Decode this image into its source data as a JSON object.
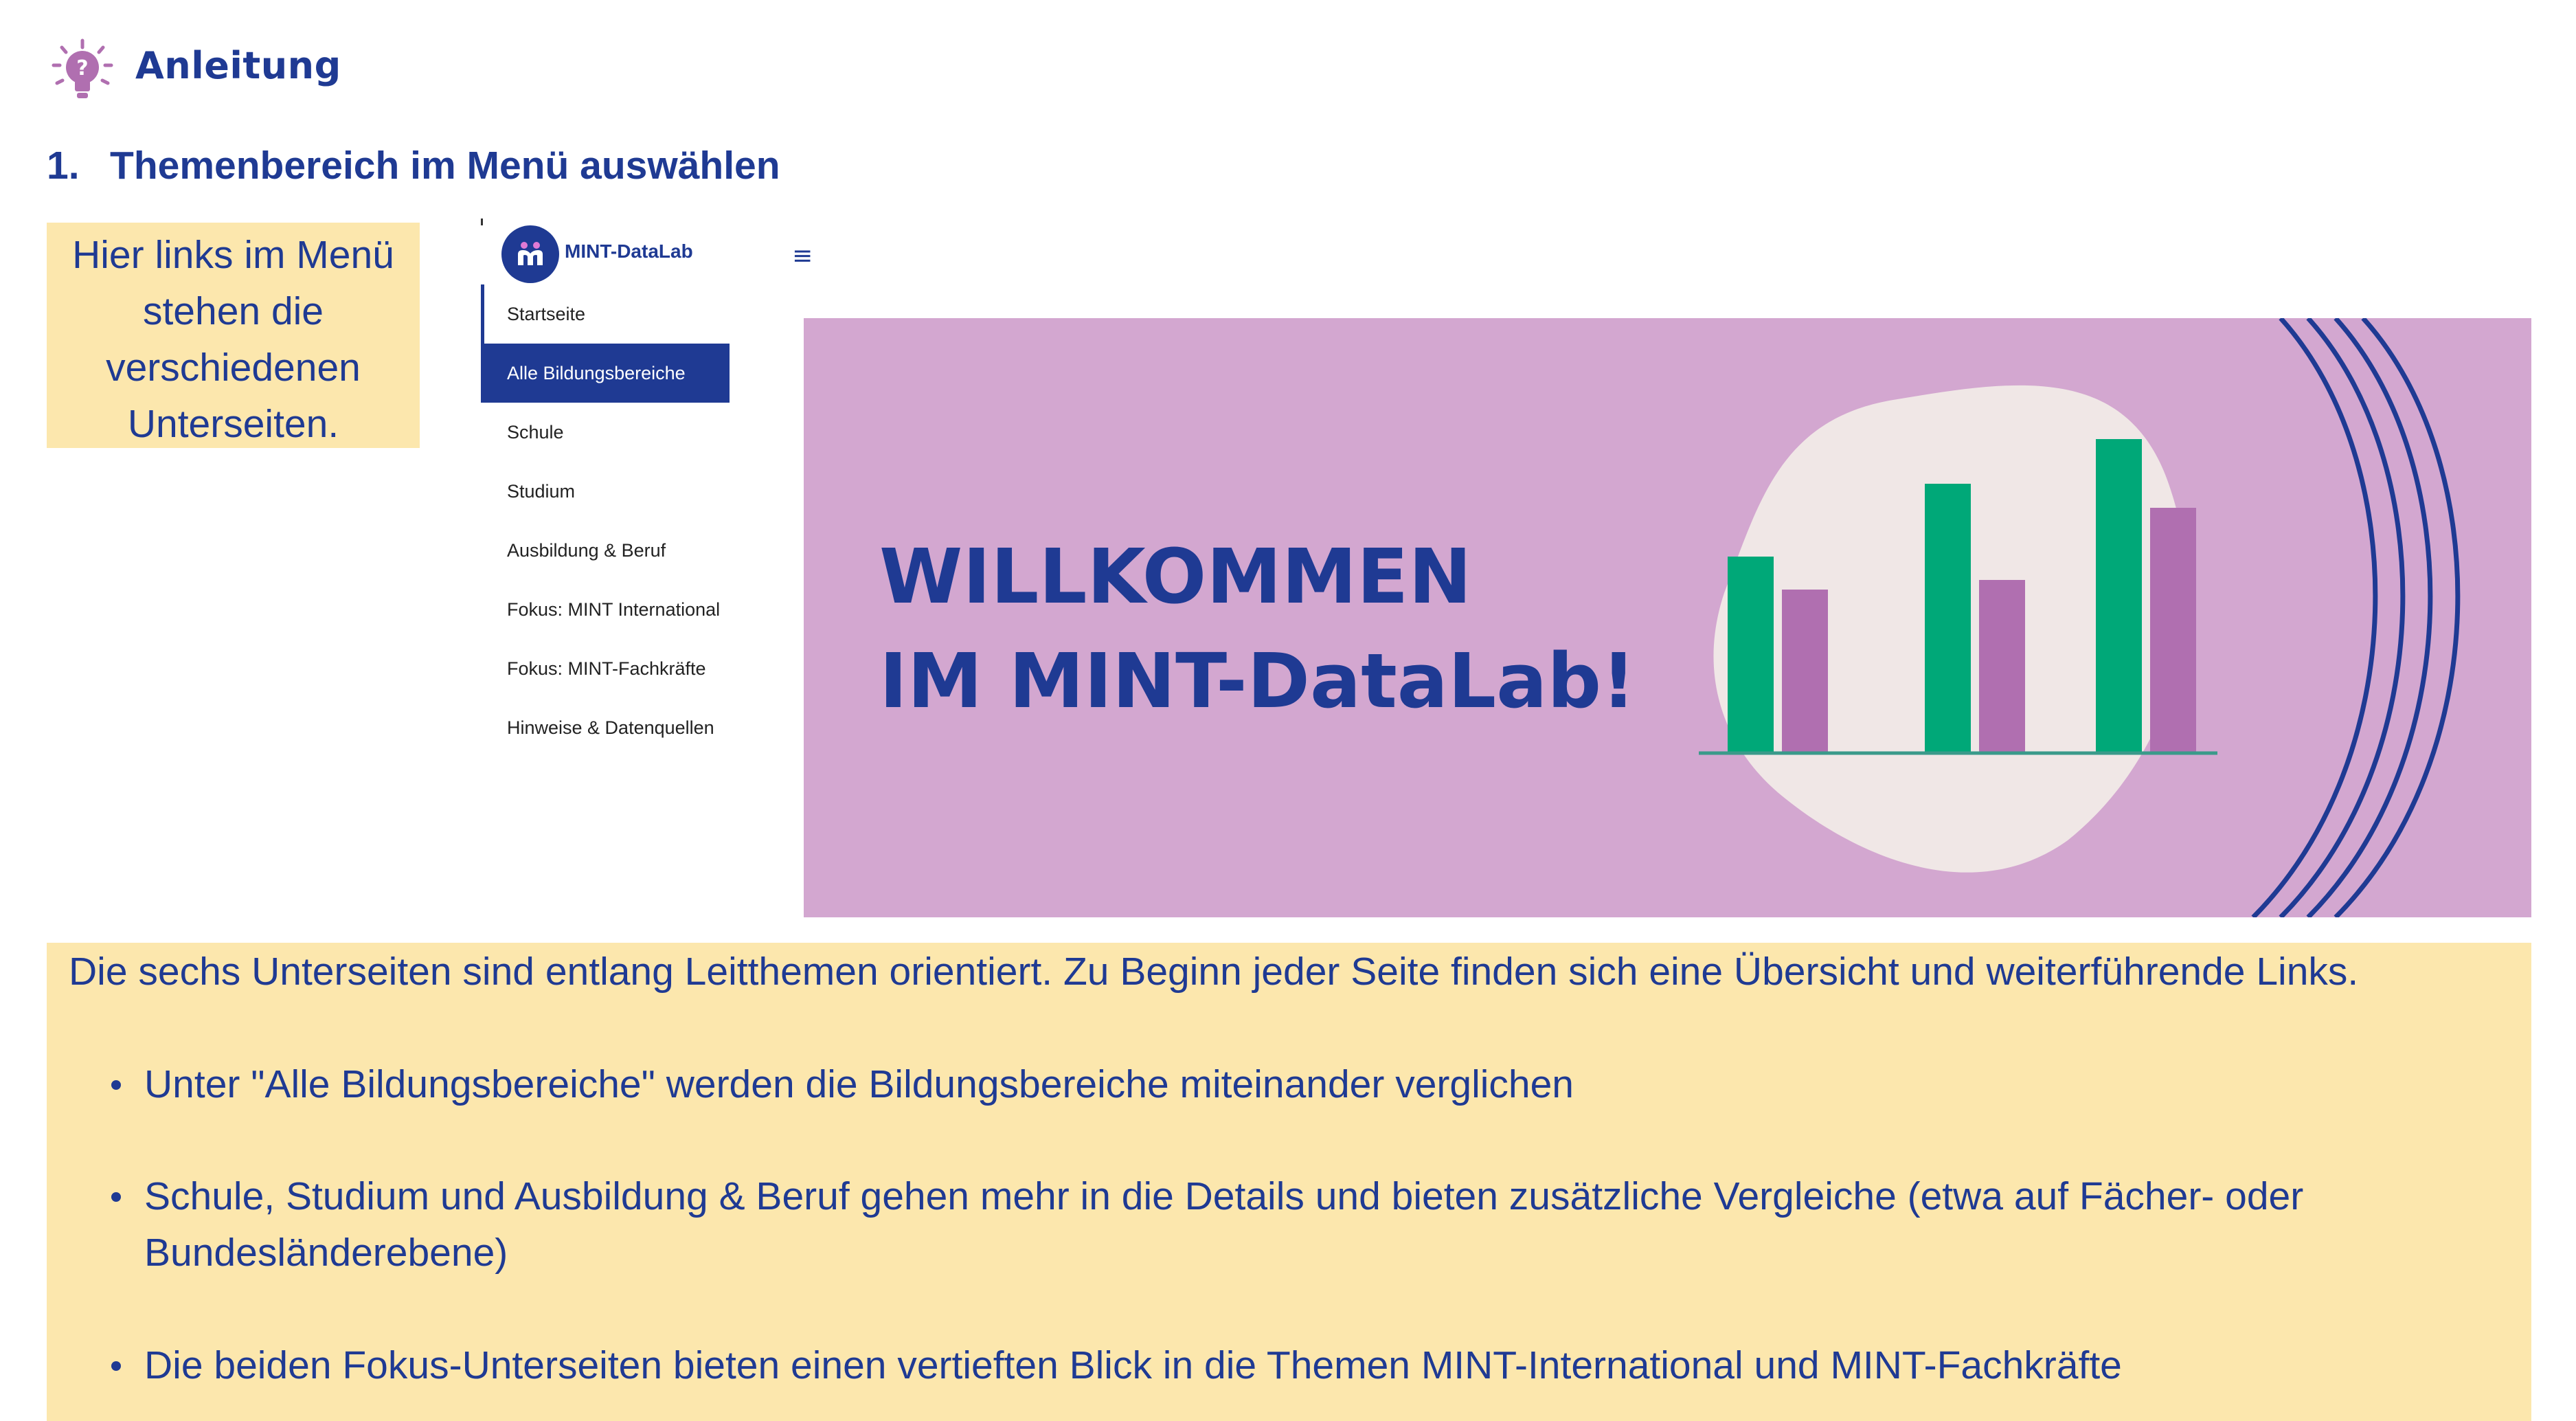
{
  "header": {
    "title": "Anleitung",
    "icon": "lightbulb-question-icon",
    "icon_color": "#b06fb0"
  },
  "step": {
    "number": "1.",
    "title": "Themenbereich im Menü auswählen"
  },
  "callout": {
    "lines": [
      "Hier links im Menü",
      "stehen die",
      "verschiedenen",
      "Unterseiten."
    ]
  },
  "menu": {
    "brand": "MINT-DataLab",
    "logo_icon": "mint-datalab-logo-icon",
    "hamburger": "≡",
    "items": [
      {
        "label": "Startseite",
        "active": false
      },
      {
        "label": "Alle Bildungsbereiche",
        "active": true
      },
      {
        "label": "Schule",
        "active": false
      },
      {
        "label": "Studium",
        "active": false
      },
      {
        "label": "Ausbildung & Beruf",
        "active": false
      },
      {
        "label": "Fokus: MINT International",
        "active": false
      },
      {
        "label": "Fokus: MINT-Fachkräfte",
        "active": false
      },
      {
        "label": "Hinweise & Datenquellen",
        "active": false
      }
    ]
  },
  "banner": {
    "line1": "WILLKOMMEN",
    "line2": "IM MINT-DataLab!",
    "background_color": "#d3a7d0",
    "bar_colors": [
      "#00a878",
      "#b06fb0"
    ]
  },
  "info": {
    "intro": "Die sechs Unterseiten sind entlang Leitthemen orientiert. Zu Beginn jeder Seite finden sich eine Übersicht und weiterführende Links.",
    "bullets": [
      "Unter \"Alle Bildungsbereiche\" werden die Bildungsbereiche miteinander verglichen",
      "Schule, Studium und Ausbildung & Beruf gehen mehr in die Details und bieten zusätzliche Vergleiche (etwa auf Fächer- oder Bundesländerebene)",
      "Die beiden Fokus-Unterseiten bieten einen vertieften Blick in die Themen MINT-International und MINT-Fachkräfte"
    ]
  },
  "colors": {
    "primary": "#1f3a93",
    "highlight": "#fce7ad"
  }
}
